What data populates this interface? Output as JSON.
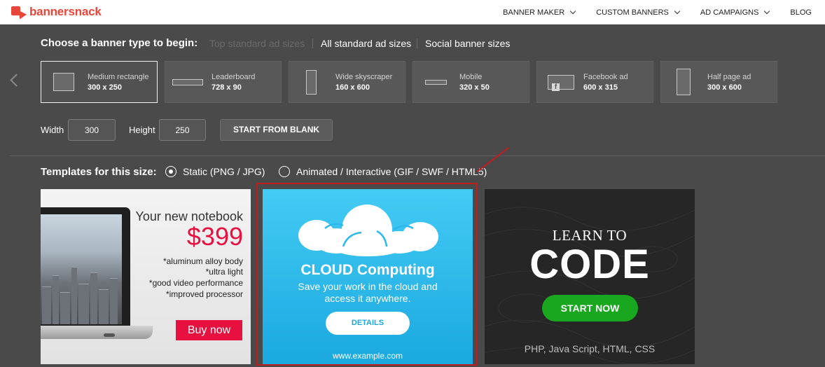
{
  "header": {
    "logo_text": "bannersnack",
    "nav": [
      {
        "label": "BANNER MAKER",
        "has_dropdown": true
      },
      {
        "label": "CUSTOM BANNERS",
        "has_dropdown": true
      },
      {
        "label": "AD CAMPAIGNS",
        "has_dropdown": true
      },
      {
        "label": "BLOG",
        "has_dropdown": false
      }
    ]
  },
  "banner_type": {
    "label": "Choose a banner type to begin:",
    "filters": [
      {
        "label": "Top standard ad sizes",
        "active": false
      },
      {
        "label": "All standard ad sizes",
        "active": true
      },
      {
        "label": "Social banner sizes",
        "active": true
      }
    ],
    "sizes": [
      {
        "name": "Medium rectangle",
        "dims": "300 x 250",
        "selected": true
      },
      {
        "name": "Leaderboard",
        "dims": "728 x 90",
        "selected": false
      },
      {
        "name": "Wide skyscraper",
        "dims": "160 x 600",
        "selected": false
      },
      {
        "name": "Mobile",
        "dims": "320 x 50",
        "selected": false
      },
      {
        "name": "Facebook ad",
        "dims": "600 x 315",
        "selected": false
      },
      {
        "name": "Half page ad",
        "dims": "300 x 600",
        "selected": false
      }
    ],
    "width_label": "Width",
    "width_value": "300",
    "height_label": "Height",
    "height_value": "250",
    "start_blank": "START FROM BLANK"
  },
  "templates": {
    "label": "Templates for this size:",
    "options": [
      {
        "label": "Static (PNG / JPG)",
        "checked": true
      },
      {
        "label": "Animated / Interactive (GIF / SWF / HTML5)",
        "checked": false
      }
    ],
    "items": [
      {
        "title": "Your new notebook",
        "price": "$399",
        "features": [
          "*aluminum alloy body",
          "*ultra light",
          "*good video performance",
          "*improved processor"
        ],
        "button": "Buy now"
      },
      {
        "title": "CLOUD Computing",
        "subtitle_1": "Save your work in the cloud and",
        "subtitle_2": "access it anywhere.",
        "button": "DETAILS",
        "url": "www.example.com",
        "highlighted": true
      },
      {
        "line1": "LEARN TO",
        "line2": "CODE",
        "button": "START NOW",
        "footer": "PHP, Java Script, HTML, CSS"
      }
    ]
  },
  "colors": {
    "brand": "#e8463a",
    "background": "#4a4a4a",
    "highlight": "#c21d1d"
  }
}
